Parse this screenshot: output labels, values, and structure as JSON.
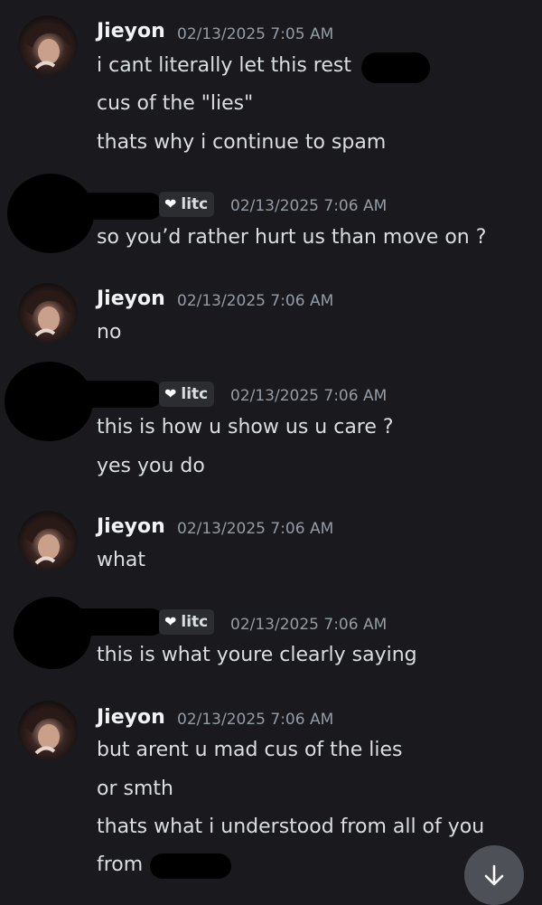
{
  "messages": [
    {
      "author": "Jieyon",
      "timestamp": "02/13/2025 7:05 AM",
      "lines": [
        "i cant literally let this rest",
        "cus of the \"lies\"",
        "thats why i continue to spam"
      ]
    },
    {
      "author": "",
      "tag": "litc",
      "timestamp": "02/13/2025 7:06 AM",
      "lines": [
        "so you’d rather hurt us than move on ?"
      ]
    },
    {
      "author": "Jieyon",
      "timestamp": "02/13/2025 7:06 AM",
      "lines": [
        "no"
      ]
    },
    {
      "author": "",
      "tag": "litc",
      "timestamp": "02/13/2025 7:06 AM",
      "lines": [
        "this is how u show us u care ?",
        "yes you do"
      ]
    },
    {
      "author": "Jieyon",
      "timestamp": "02/13/2025 7:06 AM",
      "lines": [
        "what"
      ]
    },
    {
      "author": "",
      "tag": "litc",
      "timestamp": "02/13/2025 7:06 AM",
      "lines": [
        "this is what youre clearly saying"
      ]
    },
    {
      "author": "Jieyon",
      "timestamp": "02/13/2025 7:06 AM",
      "lines": [
        "but arent u mad cus of the lies",
        "or smth",
        "thats what i understood from all of you",
        "from"
      ]
    }
  ],
  "icons": {
    "tag_icon": "heart-icon",
    "scroll_button_icon": "arrow-down-icon"
  },
  "colors": {
    "background": "#1a1a1e",
    "text": "#dbdee1",
    "username": "#f2f3f5",
    "timestamp": "#949ba4",
    "tag_background": "#2b2d31",
    "scroll_button": "#4e5058"
  }
}
